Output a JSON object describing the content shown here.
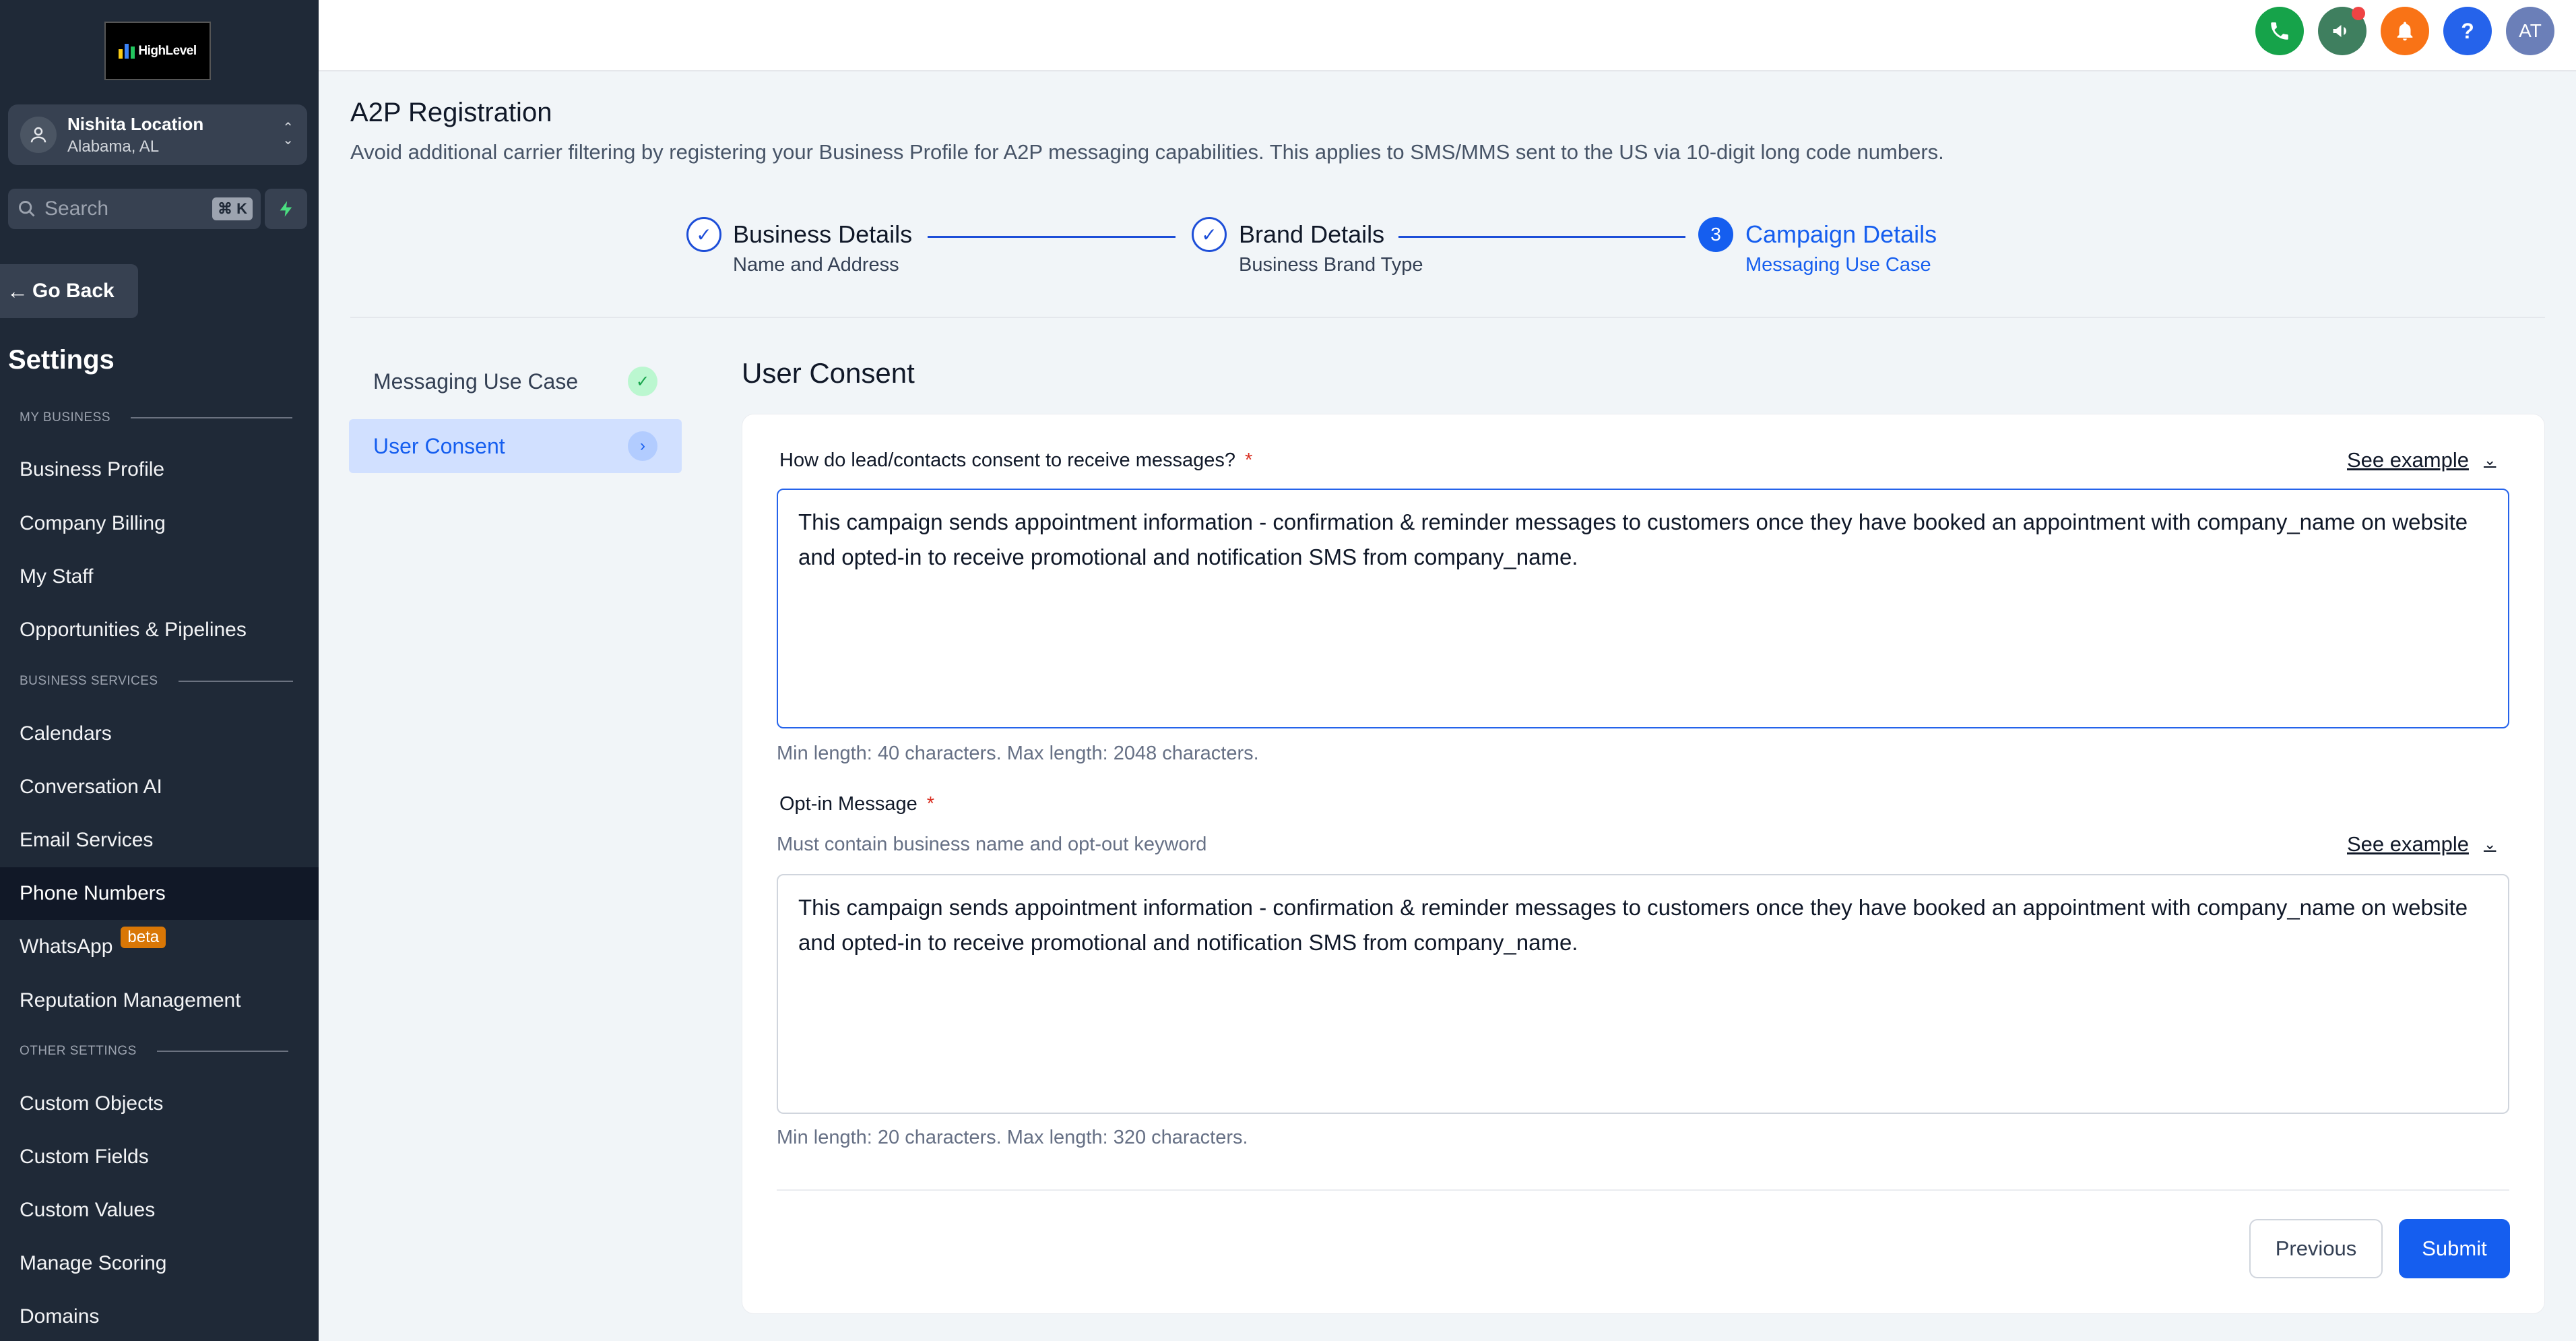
{
  "sidebar": {
    "logo_text": "HighLevel",
    "location": {
      "name": "Nishita Location",
      "sub": "Alabama, AL"
    },
    "search": {
      "placeholder": "Search",
      "shortcut": "⌘ K"
    },
    "go_back": "Go Back",
    "title": "Settings",
    "sections": {
      "my_business": "MY BUSINESS",
      "business_services": "BUSINESS SERVICES",
      "other_settings": "OTHER SETTINGS"
    },
    "items": [
      {
        "label": "Business Profile"
      },
      {
        "label": "Company Billing"
      },
      {
        "label": "My Staff"
      },
      {
        "label": "Opportunities & Pipelines"
      },
      {
        "label": "Calendars"
      },
      {
        "label": "Conversation AI"
      },
      {
        "label": "Email Services"
      },
      {
        "label": "Phone Numbers",
        "active": true
      },
      {
        "label": "WhatsApp",
        "badge": "beta"
      },
      {
        "label": "Reputation Management"
      },
      {
        "label": "Custom Objects"
      },
      {
        "label": "Custom Fields"
      },
      {
        "label": "Custom Values"
      },
      {
        "label": "Manage Scoring"
      },
      {
        "label": "Domains"
      }
    ]
  },
  "topbar": {
    "icons": [
      "phone-icon",
      "megaphone-icon",
      "bell-icon",
      "help-icon"
    ],
    "help_glyph": "?",
    "avatar_initials": "AT",
    "colors": {
      "phone": "#16a34a",
      "megaphone": "#3f7f5f",
      "bell": "#f97316",
      "help": "#2563eb",
      "avatar": "#6b7fb8"
    }
  },
  "page": {
    "title": "A2P Registration",
    "description": "Avoid additional carrier filtering by registering your Business Profile for A2P messaging capabilities. This applies to SMS/MMS sent to the US via 10-digit long code numbers."
  },
  "stepper": {
    "steps": [
      {
        "title": "Business Details",
        "sub": "Name and Address",
        "status": "done"
      },
      {
        "title": "Brand Details",
        "sub": "Business Brand Type",
        "status": "done"
      },
      {
        "title": "Campaign Details",
        "sub": "Messaging Use Case",
        "status": "current",
        "number": "3"
      }
    ]
  },
  "sub_nav": [
    {
      "label": "Messaging Use Case",
      "status": "complete"
    },
    {
      "label": "User Consent",
      "status": "active"
    }
  ],
  "form": {
    "section_title": "User Consent",
    "consent": {
      "label": "How do lead/contacts consent to receive messages?",
      "required_mark": "*",
      "see_example": "See example",
      "value": "This campaign sends appointment information - confirmation & reminder messages to customers once they have booked an appointment with company_name on website and opted-in to receive promotional and notification SMS from company_name.",
      "hint": "Min length: 40 characters. Max length: 2048 characters."
    },
    "optin": {
      "label": "Opt-in Message",
      "required_mark": "*",
      "help": "Must contain business name and opt-out keyword",
      "see_example": "See example",
      "value": "This campaign sends appointment information - confirmation & reminder messages to customers once they have booked an appointment with company_name on website and opted-in to receive promotional and notification SMS from company_name.",
      "hint": "Min length: 20 characters. Max length: 320 characters."
    },
    "buttons": {
      "previous": "Previous",
      "submit": "Submit"
    }
  },
  "colors": {
    "primary": "#155eef",
    "sidebar_bg": "#1f2937",
    "success": "#22c55e"
  }
}
